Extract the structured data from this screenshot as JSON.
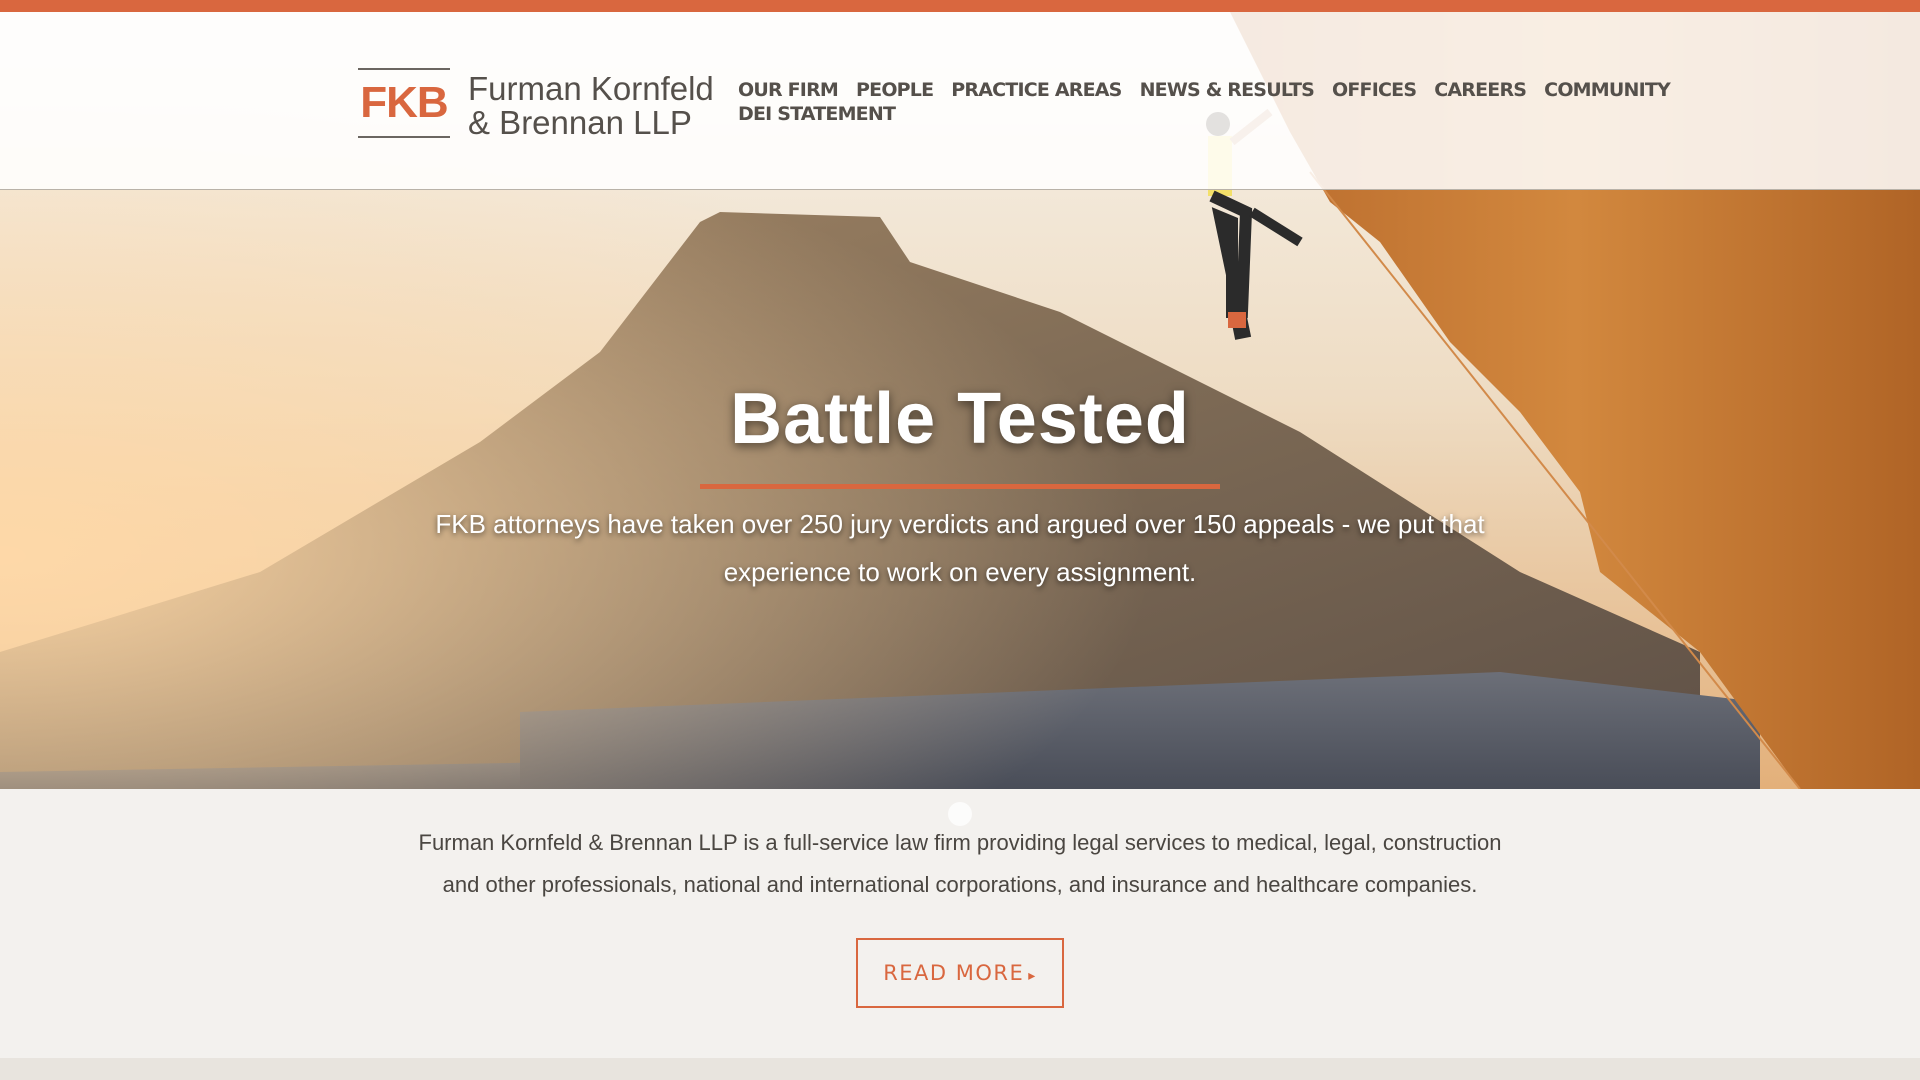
{
  "brand": {
    "mark": "FKB",
    "name_line1": "Furman Kornfeld",
    "name_line2": "& Brennan LLP"
  },
  "nav": {
    "items": [
      {
        "label": "OUR FIRM"
      },
      {
        "label": "PEOPLE"
      },
      {
        "label": "PRACTICE AREAS"
      },
      {
        "label": "NEWS & RESULTS"
      },
      {
        "label": "OFFICES"
      },
      {
        "label": "CAREERS"
      },
      {
        "label": "COMMUNITY"
      },
      {
        "label": "DEI STATEMENT"
      }
    ]
  },
  "hero": {
    "title": "Battle Tested",
    "subtitle_line1": "FKB attorneys have taken over 250 jury verdicts and argued over 150 appeals - we put that",
    "subtitle_line2": "experience to work on every assignment."
  },
  "intro": {
    "line1": "Furman Kornfeld & Brennan LLP is a full-service law firm providing legal services to medical, legal, construction",
    "line2": "and other professionals, national and international corporations, and insurance and healthcare companies."
  },
  "cta": {
    "label": "READ MORE",
    "caret": "▸"
  },
  "colors": {
    "accent": "#d9673f",
    "text": "#55504b",
    "background": "#f3f1ee"
  },
  "icons": {
    "carousel": "carousel-dot-icon",
    "cta": "caret-right-icon"
  }
}
